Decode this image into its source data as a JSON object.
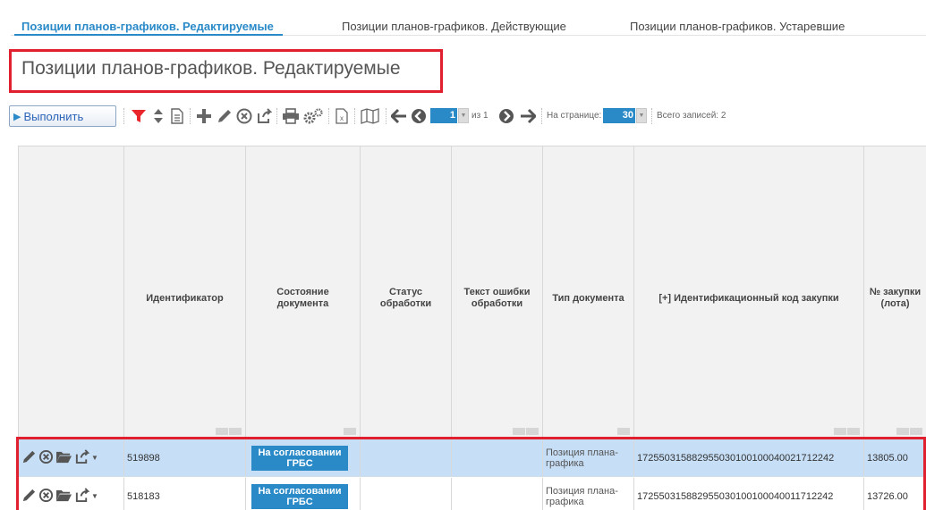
{
  "tabs": [
    {
      "label": "Позиции планов-графиков. Редактируемые"
    },
    {
      "label": "Позиции планов-графиков. Действующие"
    },
    {
      "label": "Позиции планов-графиков. Устаревшие"
    }
  ],
  "page_title": "Позиции планов-графиков. Редактируемые",
  "toolbar": {
    "run_label": "Выполнить",
    "page_value": "1",
    "page_of": "из 1",
    "per_page_label": "На странице:",
    "per_page_value": "30",
    "total_label": "Всего записей: 2"
  },
  "columns": [
    {
      "label": ""
    },
    {
      "label": "Идентификатор"
    },
    {
      "label": "Состояние документа"
    },
    {
      "label": "Статус обработки"
    },
    {
      "label": "Текст ошибки обработки"
    },
    {
      "label": "Тип документа"
    },
    {
      "label": "[+] Идентификационный код закупки"
    },
    {
      "label": "№ закупки (лота)"
    }
  ],
  "rows": [
    {
      "id": "519898",
      "state": "На согласовании ГРБС",
      "proc_status": "",
      "error_text": "",
      "doc_type": "Позиция плана-графика",
      "ikz": "172550315882955030100100040021712242",
      "lot": "13805.00",
      "selected": true
    },
    {
      "id": "518183",
      "state": "На согласовании ГРБС",
      "proc_status": "",
      "error_text": "",
      "doc_type": "Позиция плана-графика",
      "ikz": "172550315882955030100100040011712242",
      "lot": "13726.00",
      "selected": false
    }
  ],
  "colors": {
    "accent": "#2a8ac8",
    "highlight": "#e0202e",
    "row_selected": "#c6def6",
    "filter_red": "#e8262b"
  }
}
